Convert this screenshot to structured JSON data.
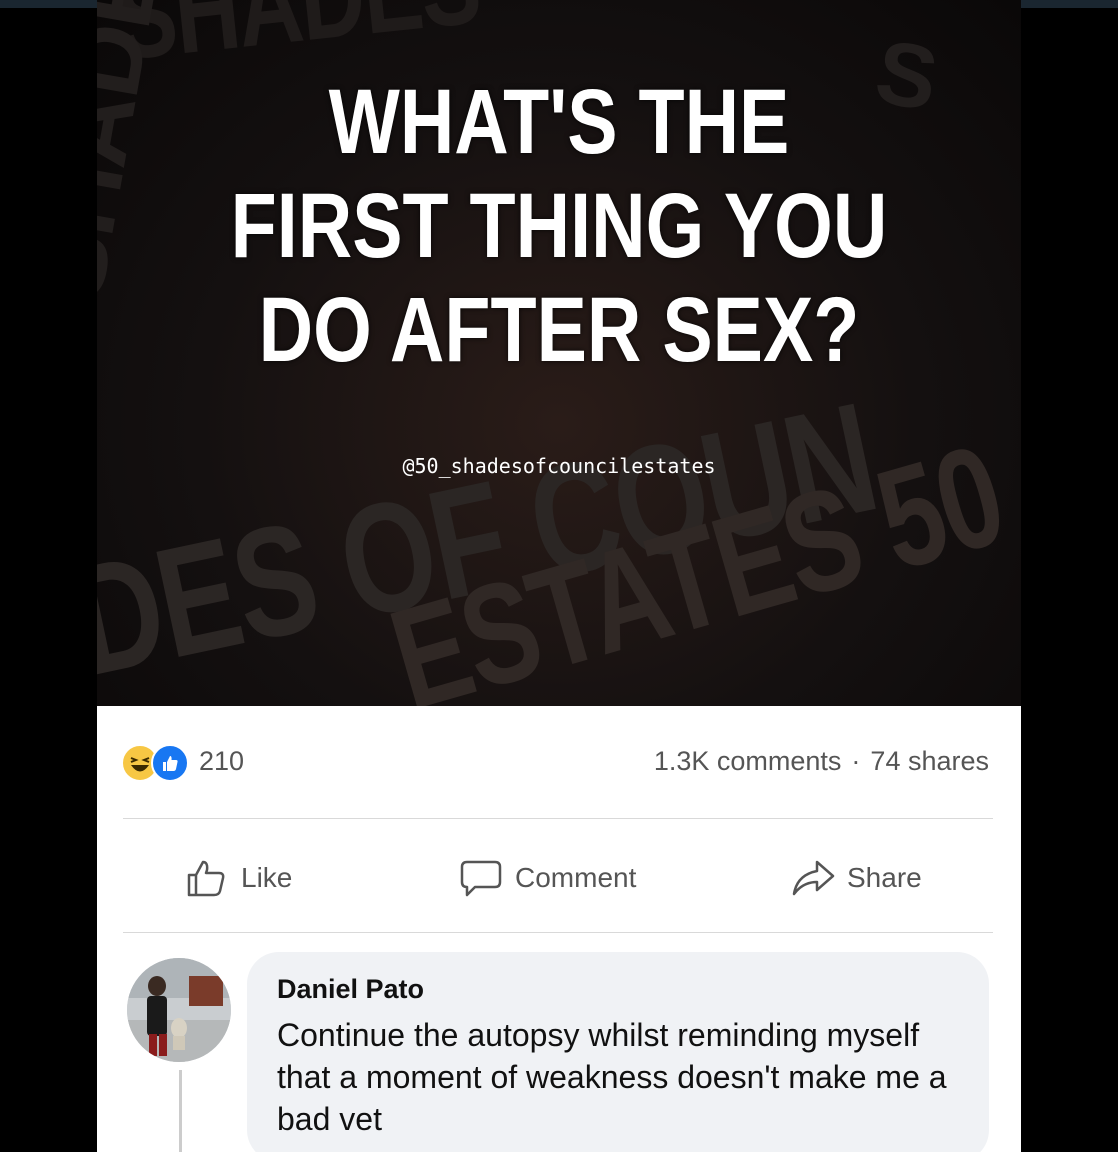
{
  "post": {
    "image": {
      "headline_lines": [
        "WHAT'S THE",
        "FIRST THING YOU",
        "DO AFTER SEX?"
      ],
      "handle": "@50_shadesofcouncilestates"
    },
    "stats": {
      "reaction_icons": [
        "haha-icon",
        "like-icon"
      ],
      "reaction_count": "210",
      "comments": "1.3K comments",
      "separator": "·",
      "shares": "74 shares"
    },
    "actions": {
      "like": "Like",
      "comment": "Comment",
      "share": "Share"
    },
    "comment": {
      "author": "Daniel Pato",
      "text": "Continue the autopsy whilst reminding myself that a moment of weakness doesn't make me a bad vet"
    }
  },
  "colors": {
    "like_blue": "#1877f2",
    "haha_yellow": "#f7c744",
    "bubble_bg": "#f0f2f5",
    "muted_text": "#555555"
  }
}
